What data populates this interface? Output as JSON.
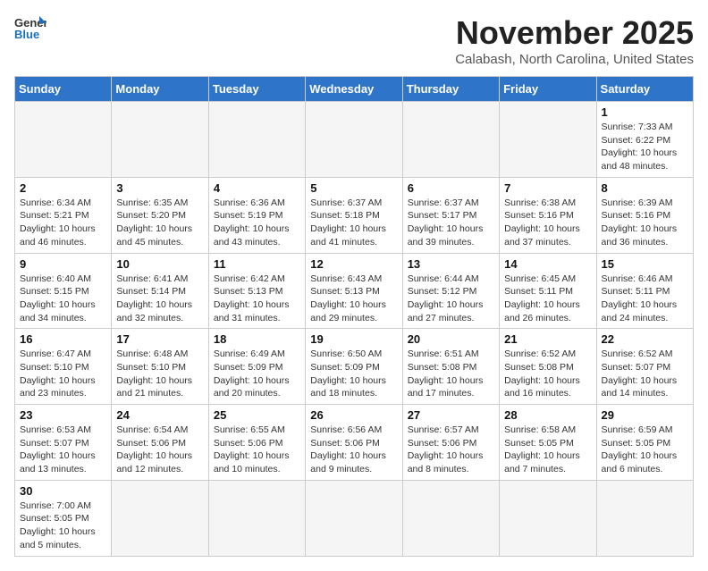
{
  "header": {
    "logo_general": "General",
    "logo_blue": "Blue",
    "title": "November 2025",
    "subtitle": "Calabash, North Carolina, United States"
  },
  "weekdays": [
    "Sunday",
    "Monday",
    "Tuesday",
    "Wednesday",
    "Thursday",
    "Friday",
    "Saturday"
  ],
  "weeks": [
    [
      {
        "day": "",
        "info": ""
      },
      {
        "day": "",
        "info": ""
      },
      {
        "day": "",
        "info": ""
      },
      {
        "day": "",
        "info": ""
      },
      {
        "day": "",
        "info": ""
      },
      {
        "day": "",
        "info": ""
      },
      {
        "day": "1",
        "info": "Sunrise: 7:33 AM\nSunset: 6:22 PM\nDaylight: 10 hours and 48 minutes."
      }
    ],
    [
      {
        "day": "2",
        "info": "Sunrise: 6:34 AM\nSunset: 5:21 PM\nDaylight: 10 hours and 46 minutes."
      },
      {
        "day": "3",
        "info": "Sunrise: 6:35 AM\nSunset: 5:20 PM\nDaylight: 10 hours and 45 minutes."
      },
      {
        "day": "4",
        "info": "Sunrise: 6:36 AM\nSunset: 5:19 PM\nDaylight: 10 hours and 43 minutes."
      },
      {
        "day": "5",
        "info": "Sunrise: 6:37 AM\nSunset: 5:18 PM\nDaylight: 10 hours and 41 minutes."
      },
      {
        "day": "6",
        "info": "Sunrise: 6:37 AM\nSunset: 5:17 PM\nDaylight: 10 hours and 39 minutes."
      },
      {
        "day": "7",
        "info": "Sunrise: 6:38 AM\nSunset: 5:16 PM\nDaylight: 10 hours and 37 minutes."
      },
      {
        "day": "8",
        "info": "Sunrise: 6:39 AM\nSunset: 5:16 PM\nDaylight: 10 hours and 36 minutes."
      }
    ],
    [
      {
        "day": "9",
        "info": "Sunrise: 6:40 AM\nSunset: 5:15 PM\nDaylight: 10 hours and 34 minutes."
      },
      {
        "day": "10",
        "info": "Sunrise: 6:41 AM\nSunset: 5:14 PM\nDaylight: 10 hours and 32 minutes."
      },
      {
        "day": "11",
        "info": "Sunrise: 6:42 AM\nSunset: 5:13 PM\nDaylight: 10 hours and 31 minutes."
      },
      {
        "day": "12",
        "info": "Sunrise: 6:43 AM\nSunset: 5:13 PM\nDaylight: 10 hours and 29 minutes."
      },
      {
        "day": "13",
        "info": "Sunrise: 6:44 AM\nSunset: 5:12 PM\nDaylight: 10 hours and 27 minutes."
      },
      {
        "day": "14",
        "info": "Sunrise: 6:45 AM\nSunset: 5:11 PM\nDaylight: 10 hours and 26 minutes."
      },
      {
        "day": "15",
        "info": "Sunrise: 6:46 AM\nSunset: 5:11 PM\nDaylight: 10 hours and 24 minutes."
      }
    ],
    [
      {
        "day": "16",
        "info": "Sunrise: 6:47 AM\nSunset: 5:10 PM\nDaylight: 10 hours and 23 minutes."
      },
      {
        "day": "17",
        "info": "Sunrise: 6:48 AM\nSunset: 5:10 PM\nDaylight: 10 hours and 21 minutes."
      },
      {
        "day": "18",
        "info": "Sunrise: 6:49 AM\nSunset: 5:09 PM\nDaylight: 10 hours and 20 minutes."
      },
      {
        "day": "19",
        "info": "Sunrise: 6:50 AM\nSunset: 5:09 PM\nDaylight: 10 hours and 18 minutes."
      },
      {
        "day": "20",
        "info": "Sunrise: 6:51 AM\nSunset: 5:08 PM\nDaylight: 10 hours and 17 minutes."
      },
      {
        "day": "21",
        "info": "Sunrise: 6:52 AM\nSunset: 5:08 PM\nDaylight: 10 hours and 16 minutes."
      },
      {
        "day": "22",
        "info": "Sunrise: 6:52 AM\nSunset: 5:07 PM\nDaylight: 10 hours and 14 minutes."
      }
    ],
    [
      {
        "day": "23",
        "info": "Sunrise: 6:53 AM\nSunset: 5:07 PM\nDaylight: 10 hours and 13 minutes."
      },
      {
        "day": "24",
        "info": "Sunrise: 6:54 AM\nSunset: 5:06 PM\nDaylight: 10 hours and 12 minutes."
      },
      {
        "day": "25",
        "info": "Sunrise: 6:55 AM\nSunset: 5:06 PM\nDaylight: 10 hours and 10 minutes."
      },
      {
        "day": "26",
        "info": "Sunrise: 6:56 AM\nSunset: 5:06 PM\nDaylight: 10 hours and 9 minutes."
      },
      {
        "day": "27",
        "info": "Sunrise: 6:57 AM\nSunset: 5:06 PM\nDaylight: 10 hours and 8 minutes."
      },
      {
        "day": "28",
        "info": "Sunrise: 6:58 AM\nSunset: 5:05 PM\nDaylight: 10 hours and 7 minutes."
      },
      {
        "day": "29",
        "info": "Sunrise: 6:59 AM\nSunset: 5:05 PM\nDaylight: 10 hours and 6 minutes."
      }
    ],
    [
      {
        "day": "30",
        "info": "Sunrise: 7:00 AM\nSunset: 5:05 PM\nDaylight: 10 hours and 5 minutes."
      },
      {
        "day": "",
        "info": ""
      },
      {
        "day": "",
        "info": ""
      },
      {
        "day": "",
        "info": ""
      },
      {
        "day": "",
        "info": ""
      },
      {
        "day": "",
        "info": ""
      },
      {
        "day": "",
        "info": ""
      }
    ]
  ]
}
